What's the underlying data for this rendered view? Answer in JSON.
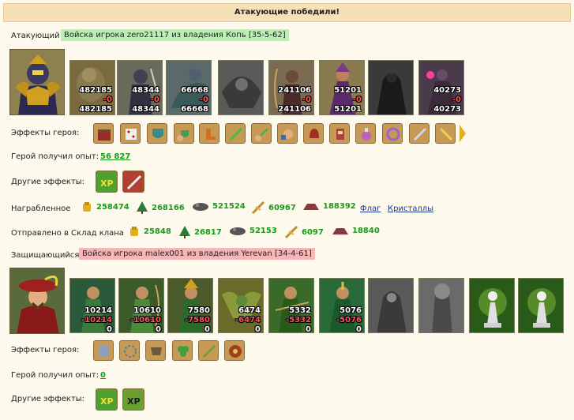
{
  "title": "Атакующие победили!",
  "attacker": {
    "label": "Атакующий",
    "army": "Войска игрока zero21117 из владения Копь [35-5-62]",
    "units": [
      {
        "name": "ogre-unit",
        "n1": "482185",
        "n2": "-0",
        "n3": "482185"
      },
      {
        "name": "dark-knight-unit",
        "n1": "48344",
        "n2": "-0",
        "n3": "48344"
      },
      {
        "name": "dragon-rider-unit",
        "n1": "66668",
        "n2": "-0",
        "n3": "66668"
      },
      {
        "name": "gargoyle-unit",
        "n1": "",
        "n2": "",
        "n3": ""
      },
      {
        "name": "archer-unit",
        "n1": "241106",
        "n2": "-0",
        "n3": "241106"
      },
      {
        "name": "sorceress-unit",
        "n1": "51201",
        "n2": "-0",
        "n3": "51201"
      },
      {
        "name": "wraith-unit",
        "n1": "",
        "n2": "",
        "n3": ""
      },
      {
        "name": "warlock-unit",
        "n1": "40273",
        "n2": "-0",
        "n3": "40273"
      }
    ],
    "effects_label": "Эффекты героя:",
    "exp_label": "Герой получил опыт:",
    "exp_value": "56 827",
    "other_label": "Другие эффекты:"
  },
  "loot": {
    "label": "Награбленное",
    "gold": "258474",
    "wood": "268166",
    "ore": "521524",
    "grain": "60967",
    "stone": "188392",
    "flag": "Флаг",
    "crystals": "Кристаллы"
  },
  "sent": {
    "label": "Отправлено в Склад клана",
    "gold": "25848",
    "wood": "26817",
    "ore": "52153",
    "grain": "6097",
    "stone": "18840"
  },
  "defender": {
    "label": "Защищающийся",
    "army": "Войска игрока malex001 из владения Yerevan [34-4-61]",
    "units": [
      {
        "name": "elf-warrior-unit",
        "n1": "10214",
        "n2": "-10214",
        "n3": "0"
      },
      {
        "name": "elf-archer-unit",
        "n1": "10610",
        "n2": "-10610",
        "n3": "0"
      },
      {
        "name": "elf-mage-unit",
        "n1": "7580",
        "n2": "-7580",
        "n3": "0"
      },
      {
        "name": "pegasus-unit",
        "n1": "6474",
        "n2": "-6474",
        "n3": "0"
      },
      {
        "name": "ranger-unit",
        "n1": "5332",
        "n2": "-5332",
        "n3": "0"
      },
      {
        "name": "druid-unit",
        "n1": "5076",
        "n2": "-5076",
        "n3": "0"
      },
      {
        "name": "monk-unit",
        "n1": "",
        "n2": "",
        "n3": ""
      },
      {
        "name": "treant-unit",
        "n1": "",
        "n2": "",
        "n3": ""
      },
      {
        "name": "pawn-tower-unit",
        "n1": "",
        "n2": "",
        "n3": ""
      },
      {
        "name": "pawn-tower2-unit",
        "n1": "",
        "n2": "",
        "n3": ""
      }
    ],
    "effects_label": "Эффекты героя:",
    "exp_label": "Герой получил опыт:",
    "exp_value": "0",
    "other_label": "Другие эффекты:"
  },
  "colors": {
    "title_bg": "#f5e0b8",
    "attacker_tag": "#b8f0b0",
    "defender_tag": "#f7b6b6",
    "value_green": "#1a9a1a",
    "loss_red": "#ff5555"
  }
}
